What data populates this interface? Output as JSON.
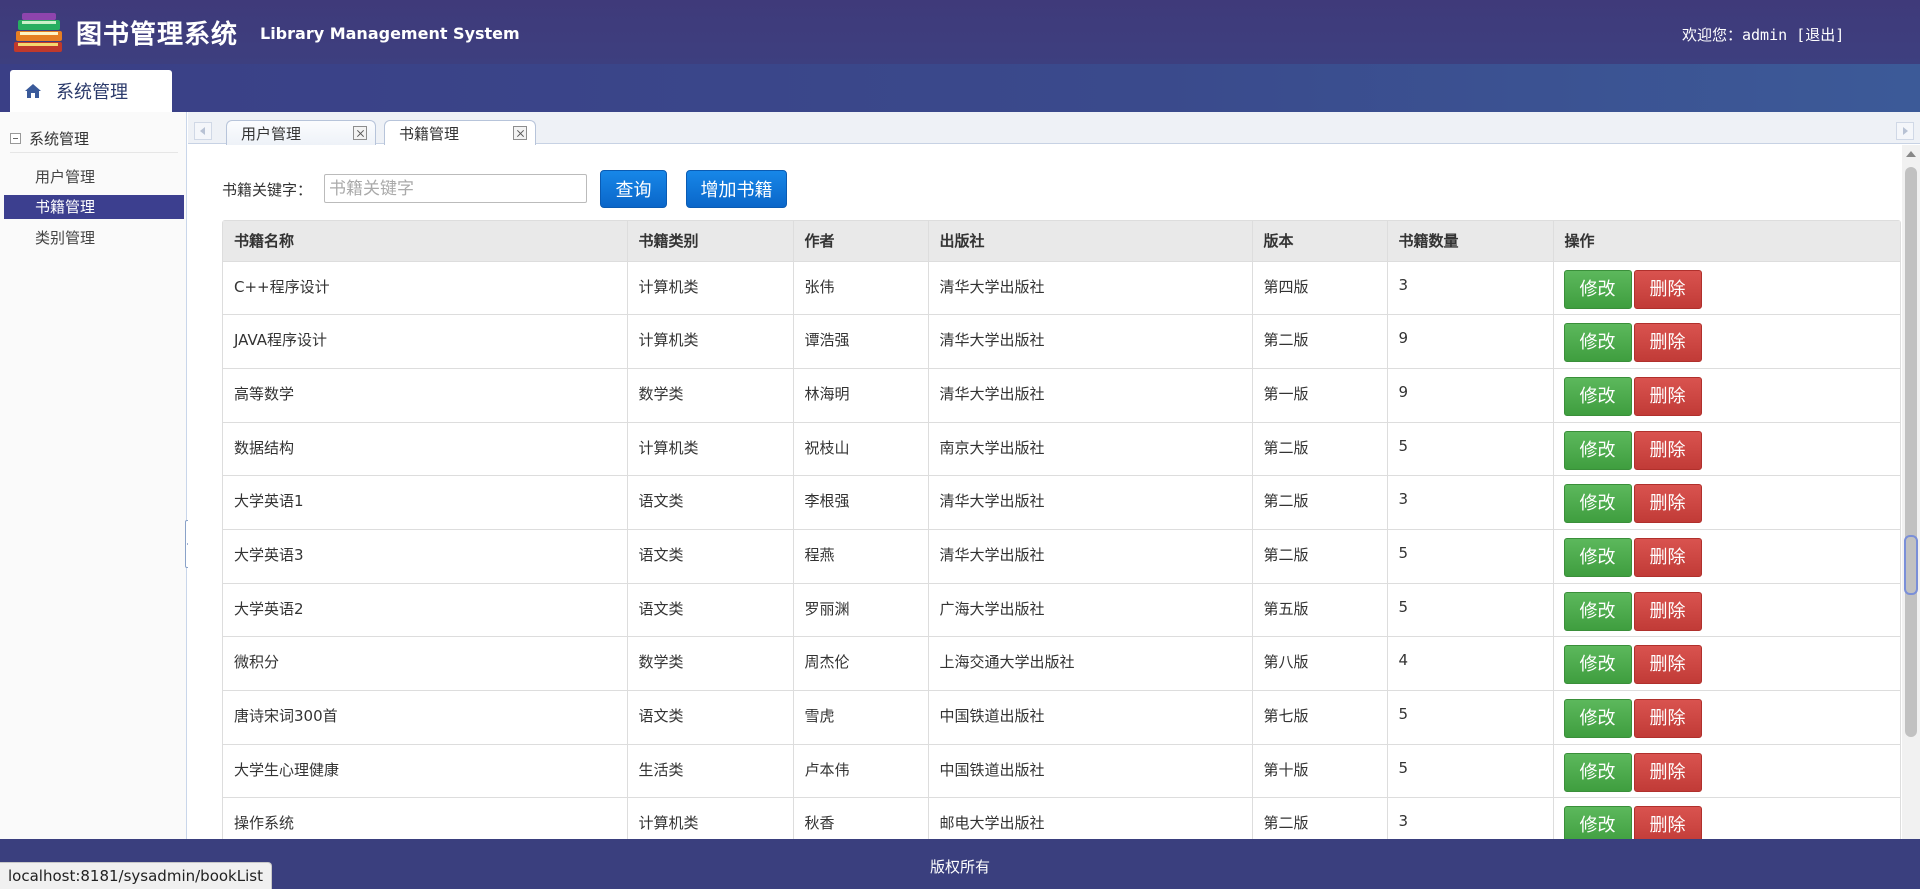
{
  "header": {
    "title_cn": "图书管理系统",
    "title_en": "Library Management System",
    "welcome": "欢迎您：admin [退出]"
  },
  "nav": {
    "tab_label": "系统管理"
  },
  "sidebar": {
    "group_label": "系统管理",
    "items": [
      {
        "label": "用户管理",
        "active": false
      },
      {
        "label": "书籍管理",
        "active": true
      },
      {
        "label": "类别管理",
        "active": false
      }
    ]
  },
  "tabs": [
    {
      "label": "用户管理",
      "active": false
    },
    {
      "label": "书籍管理",
      "active": true
    }
  ],
  "search": {
    "label": "书籍关键字：",
    "placeholder": "书籍关键字",
    "query_label": "查询",
    "add_label": "增加书籍"
  },
  "table": {
    "headers": [
      "书籍名称",
      "书籍类别",
      "作者",
      "出版社",
      "版本",
      "书籍数量",
      "操作"
    ],
    "edit_label": "修改",
    "delete_label": "删除",
    "rows": [
      [
        "C++程序设计",
        "计算机类",
        "张伟",
        "清华大学出版社",
        "第四版",
        "3"
      ],
      [
        "JAVA程序设计",
        "计算机类",
        "谭浩强",
        "清华大学出版社",
        "第二版",
        "9"
      ],
      [
        "高等数学",
        "数学类",
        "林海明",
        "清华大学出版社",
        "第一版",
        "9"
      ],
      [
        "数据结构",
        "计算机类",
        "祝枝山",
        "南京大学出版社",
        "第二版",
        "5"
      ],
      [
        "大学英语1",
        "语文类",
        "李根强",
        "清华大学出版社",
        "第二版",
        "3"
      ],
      [
        "大学英语3",
        "语文类",
        "程燕",
        "清华大学出版社",
        "第二版",
        "5"
      ],
      [
        "大学英语2",
        "语文类",
        "罗丽渊",
        "广海大学出版社",
        "第五版",
        "5"
      ],
      [
        "微积分",
        "数学类",
        "周杰伦",
        "上海交通大学出版社",
        "第八版",
        "4"
      ],
      [
        "唐诗宋词300首",
        "语文类",
        "雪虎",
        "中国铁道出版社",
        "第七版",
        "5"
      ],
      [
        "大学生心理健康",
        "生活类",
        "卢本伟",
        "中国铁道出版社",
        "第十版",
        "5"
      ],
      [
        "操作系统",
        "计算机类",
        "秋香",
        "邮电大学出版社",
        "第二版",
        "3"
      ]
    ]
  },
  "footer": {
    "copyright": "版权所有"
  },
  "status_url": "localhost:8181/sysadmin/bookList",
  "colors": {
    "header": "#3f3a7a",
    "active_item": "#3c3f8f",
    "edit": "#5cb85c",
    "delete": "#d9534f",
    "primary": "#0a66c9"
  }
}
